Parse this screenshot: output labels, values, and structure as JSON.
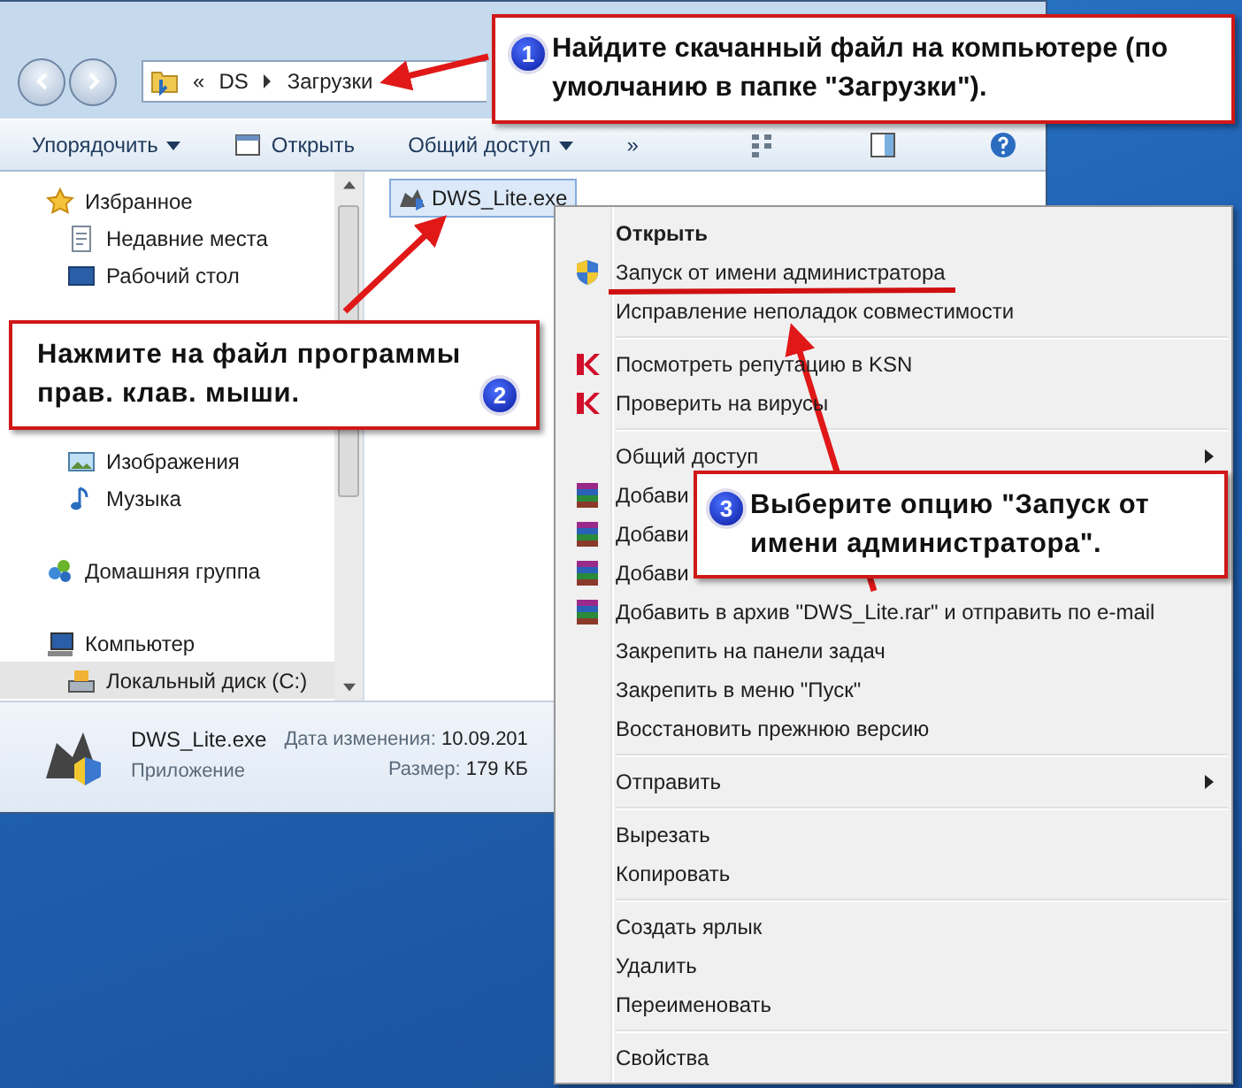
{
  "window": {
    "address": {
      "chevron": "«",
      "crumbs": [
        "DS",
        "Загрузки"
      ]
    },
    "toolbar": [
      {
        "label": "Упорядочить",
        "dropdown": true
      },
      {
        "label": "Открыть",
        "dropdown": false
      },
      {
        "label": "Общий доступ",
        "dropdown": true
      },
      {
        "label": "»",
        "dropdown": false
      }
    ],
    "sidebar": [
      {
        "label": "Избранное",
        "selected": false,
        "children": [
          {
            "label": "Недавние места",
            "selected": false
          },
          {
            "label": "Рабочий стол",
            "selected": false
          }
        ]
      },
      {
        "children": [
          {
            "label": "Изображения",
            "selected": false
          },
          {
            "label": "Музыка",
            "selected": false
          }
        ]
      },
      {
        "label": "Домашняя группа",
        "selected": false
      },
      {
        "label": "Компьютер",
        "selected": false,
        "children": [
          {
            "label": "Локальный диск (C:)",
            "selected": true
          }
        ]
      }
    ],
    "files": [
      {
        "name": "DWS_Lite.exe",
        "selected": true
      }
    ],
    "details": {
      "name": "DWS_Lite.exe",
      "type": "Приложение",
      "modified_label": "Дата изменения:",
      "modified_value": "10.09.201",
      "size_label": "Размер:",
      "size_value": "179 КБ"
    }
  },
  "context_menu": [
    {
      "kind": "plain",
      "label": "Открыть",
      "bold": true,
      "submenu": false
    },
    {
      "kind": "shield",
      "label": "Запуск от имени администратора",
      "bold": false,
      "submenu": false
    },
    {
      "kind": "plain",
      "label": "Исправление неполадок совместимости",
      "bold": false,
      "submenu": false
    },
    {
      "kind": "separator"
    },
    {
      "kind": "antivirus",
      "label": "Посмотреть репутацию в KSN",
      "bold": false,
      "submenu": false
    },
    {
      "kind": "antivirus",
      "label": "Проверить на вирусы",
      "bold": false,
      "submenu": false
    },
    {
      "kind": "separator"
    },
    {
      "kind": "plain",
      "label": "Общий доступ",
      "bold": false,
      "submenu": true
    },
    {
      "kind": "archive",
      "label": "Добави",
      "bold": false
    },
    {
      "kind": "archive",
      "label": "Добави",
      "bold": false
    },
    {
      "kind": "archive",
      "label": "Добави",
      "bold": false
    },
    {
      "kind": "archive",
      "label": "Добавить в архив \"DWS_Lite.rar\" и отправить по e-mail",
      "bold": false,
      "submenu": false
    },
    {
      "kind": "plain",
      "label": "Закрепить на панели задач",
      "bold": false,
      "submenu": false
    },
    {
      "kind": "plain",
      "label": "Закрепить в меню \"Пуск\"",
      "bold": false,
      "submenu": false
    },
    {
      "kind": "plain",
      "label": "Восстановить прежнюю версию",
      "bold": false,
      "submenu": false
    },
    {
      "kind": "separator"
    },
    {
      "kind": "plain",
      "label": "Отправить",
      "bold": false,
      "submenu": true
    },
    {
      "kind": "separator"
    },
    {
      "kind": "plain",
      "label": "Вырезать",
      "bold": false,
      "submenu": false
    },
    {
      "kind": "plain",
      "label": "Копировать",
      "bold": false,
      "submenu": false
    },
    {
      "kind": "separator"
    },
    {
      "kind": "plain",
      "label": "Создать ярлык",
      "bold": false,
      "submenu": false
    },
    {
      "kind": "plain",
      "label": "Удалить",
      "bold": false,
      "submenu": false
    },
    {
      "kind": "plain",
      "label": "Переименовать",
      "bold": false,
      "submenu": false
    },
    {
      "kind": "separator"
    },
    {
      "kind": "plain",
      "label": "Свойства",
      "bold": false,
      "submenu": false
    }
  ],
  "callouts": [
    {
      "number": "1",
      "text": "Найдите скачанный файл на компьютере (по умолчанию в папке \"Загрузки\")."
    },
    {
      "number": "2",
      "text": "Нажмите на файл программы прав. клав. мыши."
    },
    {
      "number": "3",
      "text": "Выберите опцию \"Запуск от имени администратора\"."
    }
  ]
}
